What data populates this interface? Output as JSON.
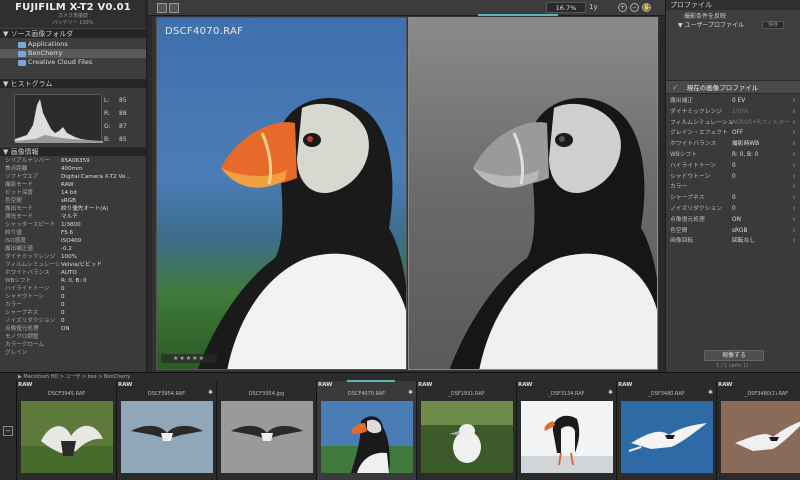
{
  "app": {
    "title": "FUJIFILM X-T2   V0.01",
    "subtitle_l1": "カメラ未接続",
    "subtitle_l2": "バッテリー 100%"
  },
  "left": {
    "source_header": "▼ ソース画像フォルダ",
    "folders": [
      {
        "label": "Applications",
        "selected": false
      },
      {
        "label": "BenCherry",
        "selected": true
      },
      {
        "label": "Creative Cloud Files",
        "selected": false
      }
    ],
    "histogram_header": "▼ ヒストグラム",
    "histogram_values": [
      {
        "k": "L:",
        "v": "85"
      },
      {
        "k": "R:",
        "v": "88"
      },
      {
        "k": "G:",
        "v": "87"
      },
      {
        "k": "B:",
        "v": "85"
      }
    ],
    "info_header": "▼ 画像情報",
    "info": [
      {
        "k": "シリアルナンバー",
        "v": "65A06359"
      },
      {
        "k": "焦点距離",
        "v": "400mm"
      },
      {
        "k": "ソフトウエア",
        "v": "Digital Camera X-T2 Ve..."
      },
      {
        "k": "撮影モード",
        "v": "RAW"
      },
      {
        "k": "ビット深度",
        "v": "14 bit"
      },
      {
        "k": "色空間",
        "v": "sRGB"
      },
      {
        "k": "露出モード",
        "v": "絞り優先オート(A)"
      },
      {
        "k": "測光モード",
        "v": "マルチ"
      },
      {
        "k": "シャッタースピード",
        "v": "1/3800"
      },
      {
        "k": "絞り値",
        "v": "F5.6"
      },
      {
        "k": "ISO感度",
        "v": "ISO400"
      },
      {
        "k": "露出補正値",
        "v": "-0.2"
      },
      {
        "k": "ダイナミックレンジ",
        "v": "100%"
      },
      {
        "k": "フィルムシミュレーション",
        "v": "Velvia/ビビッド"
      },
      {
        "k": "ホワイトバランス",
        "v": "AUTO"
      },
      {
        "k": "WBシフト",
        "v": "R: 0, B: 0"
      },
      {
        "k": "ハイライトトーン",
        "v": "0"
      },
      {
        "k": "シャドウトーン",
        "v": "0"
      },
      {
        "k": "カラー",
        "v": "0"
      },
      {
        "k": "シャープネス",
        "v": "0"
      },
      {
        "k": "ノイズリダクション",
        "v": "0"
      },
      {
        "k": "点像復元処理",
        "v": "ON"
      },
      {
        "k": "モノクロ調整",
        "v": ""
      },
      {
        "k": "カラークローム",
        "v": ""
      },
      {
        "k": "グレイン",
        "v": ""
      }
    ]
  },
  "toolbar": {
    "zoom": "16.7%",
    "fit_label": "1y"
  },
  "view": {
    "filename": "DSCF4070.RAF",
    "rating": "★★★★★"
  },
  "right": {
    "profile_header": "プロファイル",
    "profile_l1": "撮影条件を反映",
    "profile_l2": "▼ ユーザープロファイル",
    "profile_dd": "保存",
    "current_profile": "現在の画像プロファイル",
    "params": [
      {
        "k": "露出補正",
        "v": "0 EV",
        "dim": false
      },
      {
        "k": "ダイナミックレンジ",
        "v": "100%",
        "dim": true
      },
      {
        "k": "フィルムシミュレーション",
        "v": "ACROS+Rフィルター",
        "dim": true
      },
      {
        "k": "グレイン・エフェクト",
        "v": "OFF",
        "dim": false
      },
      {
        "k": "ホワイトバランス",
        "v": "撮影時WB",
        "dim": false
      },
      {
        "k": "WBシフト",
        "v": "R: 0, B: 0",
        "dim": false
      },
      {
        "k": "ハイライトトーン",
        "v": "0",
        "dim": false
      },
      {
        "k": "シャドウトーン",
        "v": "0",
        "dim": false
      },
      {
        "k": "カラー",
        "v": "",
        "dim": false
      },
      {
        "k": "シャープネス",
        "v": "0",
        "dim": false
      },
      {
        "k": "ノイズリダクション",
        "v": "0",
        "dim": false
      },
      {
        "k": "点像復元処理",
        "v": "ON",
        "dim": false
      },
      {
        "k": "色空間",
        "v": "sRGB",
        "dim": false
      },
      {
        "k": "画像回転",
        "v": "回転なし",
        "dim": false
      }
    ],
    "convert_button": "現像する",
    "convert_sub": "1 / 1 (with 1)"
  },
  "filmstrip": {
    "header": "▶ Macintosh HD > ユーザ > bse > BenCherry",
    "thumbs": [
      {
        "raw": "RAW",
        "name": "DSCF3945.RAF",
        "ast": "",
        "selected": false,
        "scene": "eagle"
      },
      {
        "raw": "RAW",
        "name": "DSCF3954.RAF",
        "ast": "✱",
        "selected": false,
        "scene": "flight"
      },
      {
        "raw": "",
        "name": "DSCF3954.jpg",
        "ast": "",
        "selected": false,
        "scene": "flight-mono"
      },
      {
        "raw": "RAW",
        "name": "DSCF4070.RAF",
        "ast": "✱",
        "selected": true,
        "scene": "puffin"
      },
      {
        "raw": "RAW",
        "name": "_DSF1931.RAF",
        "ast": "",
        "selected": false,
        "scene": "gannet"
      },
      {
        "raw": "RAW",
        "name": "_DSF3134.RAF",
        "ast": "✱",
        "selected": false,
        "scene": "puffin2"
      },
      {
        "raw": "RAW",
        "name": "_DSF3480.RAF",
        "ast": "✱",
        "selected": false,
        "scene": "tern"
      },
      {
        "raw": "RAW",
        "name": "_DSF3480(1).RAF",
        "ast": "",
        "selected": false,
        "scene": "tern2"
      }
    ]
  },
  "colors": {
    "accent": "#5ab8b0",
    "panel": "#3a3a3a"
  }
}
